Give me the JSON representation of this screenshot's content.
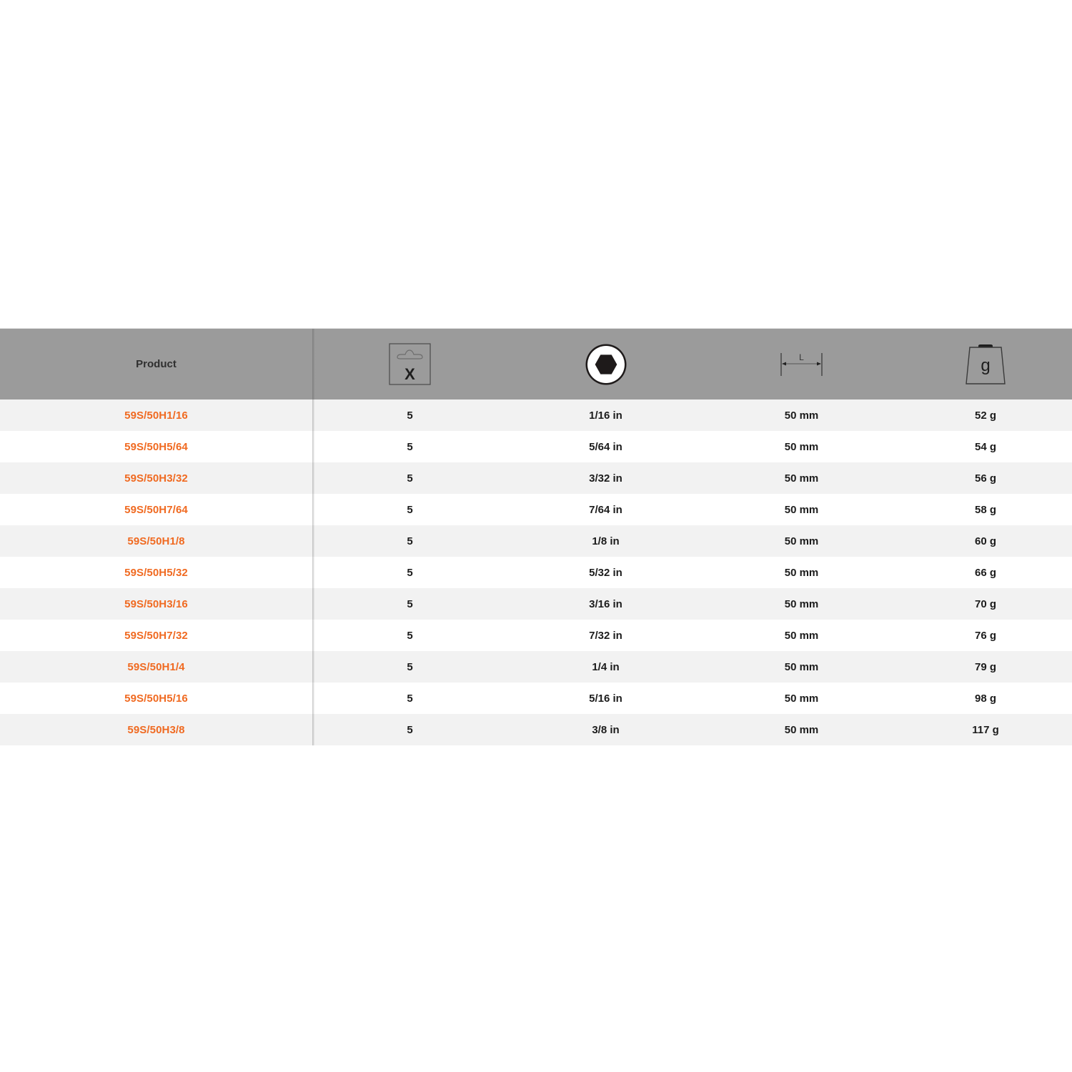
{
  "table": {
    "header": {
      "product_label": "Product",
      "columns": [
        {
          "key": "pack_quantity",
          "icon": "hang-pack-quantity-icon",
          "icon_text": "X"
        },
        {
          "key": "hex_size",
          "icon": "hex-socket-icon"
        },
        {
          "key": "length",
          "icon": "length-dimension-icon",
          "icon_text": "L"
        },
        {
          "key": "weight",
          "icon": "weight-icon",
          "icon_text": "g"
        }
      ]
    },
    "rows": [
      {
        "product": "59S/50H1/16",
        "qty": "5",
        "size": "1/16 in",
        "length": "50 mm",
        "weight": "52 g"
      },
      {
        "product": "59S/50H5/64",
        "qty": "5",
        "size": "5/64 in",
        "length": "50 mm",
        "weight": "54 g"
      },
      {
        "product": "59S/50H3/32",
        "qty": "5",
        "size": "3/32 in",
        "length": "50 mm",
        "weight": "56 g"
      },
      {
        "product": "59S/50H7/64",
        "qty": "5",
        "size": "7/64 in",
        "length": "50 mm",
        "weight": "58 g"
      },
      {
        "product": "59S/50H1/8",
        "qty": "5",
        "size": "1/8 in",
        "length": "50 mm",
        "weight": "60 g"
      },
      {
        "product": "59S/50H5/32",
        "qty": "5",
        "size": "5/32 in",
        "length": "50 mm",
        "weight": "66 g"
      },
      {
        "product": "59S/50H3/16",
        "qty": "5",
        "size": "3/16 in",
        "length": "50 mm",
        "weight": "70 g"
      },
      {
        "product": "59S/50H7/32",
        "qty": "5",
        "size": "7/32 in",
        "length": "50 mm",
        "weight": "76 g"
      },
      {
        "product": "59S/50H1/4",
        "qty": "5",
        "size": "1/4 in",
        "length": "50 mm",
        "weight": "79 g"
      },
      {
        "product": "59S/50H5/16",
        "qty": "5",
        "size": "5/16 in",
        "length": "50 mm",
        "weight": "98 g"
      },
      {
        "product": "59S/50H3/8",
        "qty": "5",
        "size": "3/8 in",
        "length": "50 mm",
        "weight": "117 g"
      }
    ]
  },
  "colors": {
    "header_bg": "#9b9b9b",
    "row_alt_bg": "#f2f2f2",
    "row_bg": "#ffffff",
    "product_link": "#f06a21",
    "value_text": "#1c1c1c"
  }
}
